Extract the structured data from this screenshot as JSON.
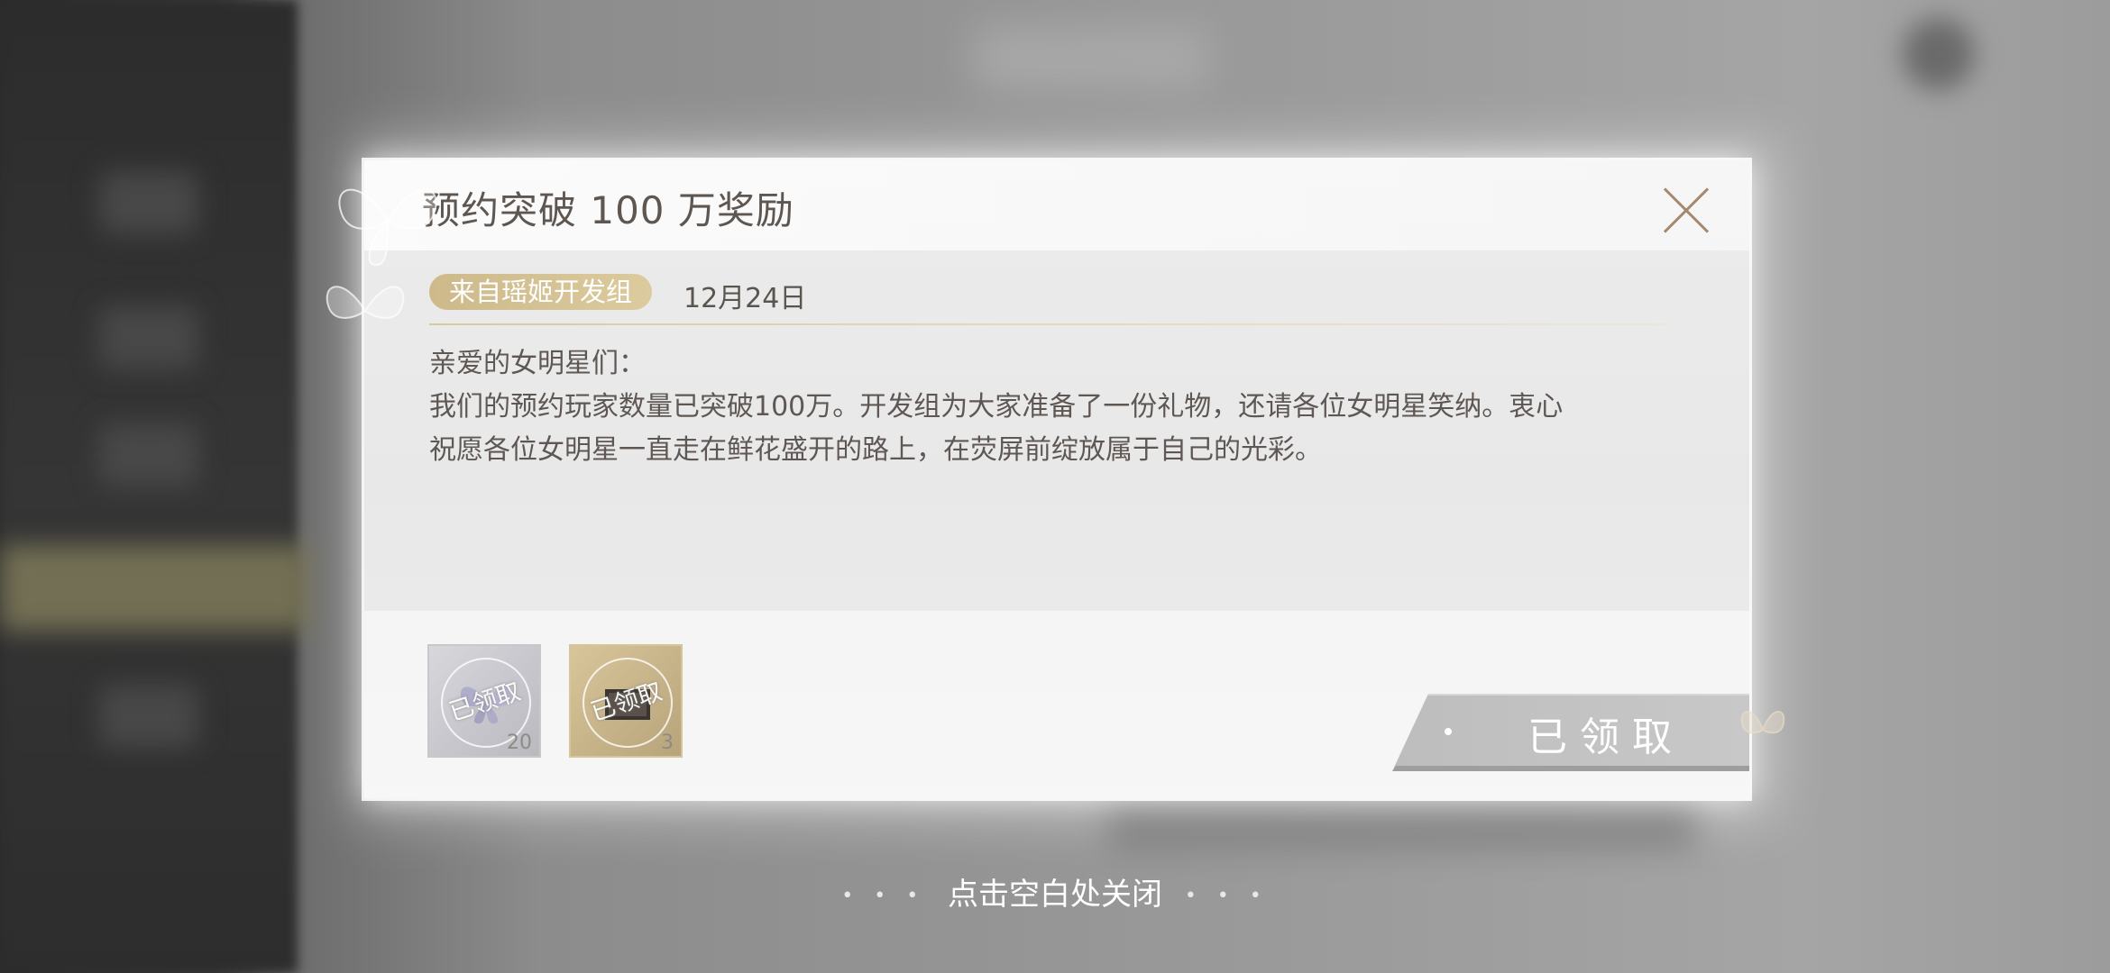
{
  "dialog": {
    "title": "预约突破 100 万奖励",
    "sender": "来自瑶姬开发组",
    "date": "12月24日",
    "greeting": "亲爱的女明星们：",
    "line1": "我们的预约玩家数量已突破100万。开发组为大家准备了一份礼物，还请各位女明星笑纳。衷心",
    "line2": "祝愿各位女明星一直走在鲜花盛开的路上，在荧屏前绽放属于自己的光彩。"
  },
  "rewards": [
    {
      "icon": "butterfly-icon",
      "status": "已领取",
      "count": "20"
    },
    {
      "icon": "photo-card-icon",
      "status": "已领取",
      "count": "3"
    }
  ],
  "claim_button": {
    "label": "已领取"
  },
  "hint": {
    "text": "点击空白处关闭",
    "left_dots": "• • •",
    "right_dots": "• • •"
  },
  "colors": {
    "badge": "#d4c290",
    "close": "#a5886e",
    "title": "#5e5650"
  }
}
